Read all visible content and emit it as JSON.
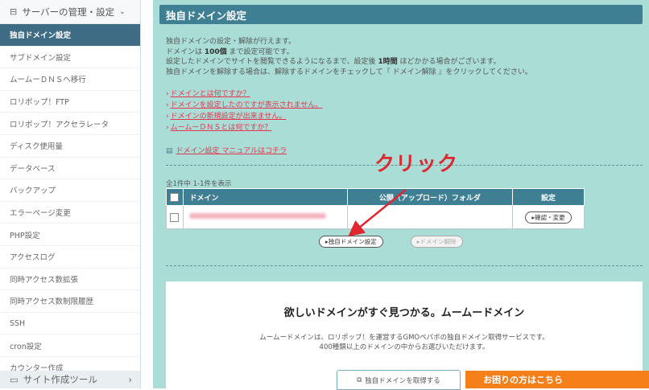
{
  "sidebar": {
    "header_icon": "server-icon",
    "header": "サーバーの管理・設定",
    "items": [
      {
        "label": "独自ドメイン設定",
        "active": true
      },
      {
        "label": "サブドメイン設定"
      },
      {
        "label": "ムームーＤＮＳへ移行"
      },
      {
        "label": "ロリポップ！FTP"
      },
      {
        "label": "ロリポップ！アクセラレータ"
      },
      {
        "label": "ディスク使用量"
      },
      {
        "label": "データベース"
      },
      {
        "label": "バックアップ"
      },
      {
        "label": "エラーページ変更"
      },
      {
        "label": "PHP設定"
      },
      {
        "label": "アクセスログ"
      },
      {
        "label": "同時アクセス数拡張"
      },
      {
        "label": "同時アクセス数制限履歴"
      },
      {
        "label": "SSH"
      },
      {
        "label": "cron設定"
      },
      {
        "label": "カウンター作成"
      }
    ],
    "footer": "サイト作成ツール"
  },
  "page": {
    "title": "独自ドメイン設定",
    "desc1": "独自ドメインの設定・解除が行えます。",
    "desc2_pre": "ドメインは ",
    "desc2_bold": "100個",
    "desc2_post": " まで設定可能です。",
    "desc3_pre": "設定したドメインでサイトを閲覧できるようになるまで、設定後 ",
    "desc3_bold": "1時間",
    "desc3_post": " ほどかかる場合がございます。",
    "desc4": "独自ドメインを解除する場合は、解除するドメインをチェックして『 ドメイン解除 』をクリックしてください。",
    "links": [
      "ドメインとは何ですか？",
      "ドメインを設定したのですが表示されません。",
      "ドメインの新規設定が出来ません。",
      "ムームーＤＮＳとは何ですか？"
    ],
    "manual": "ドメイン設定 マニュアルはコチラ",
    "count": "全1件中 1-1件を表示",
    "table": {
      "col_domain": "ドメイン",
      "col_folder": "公開（アップロード）フォルダ",
      "col_setting": "設定",
      "edit_btn": "確認・変更"
    },
    "set_btn": "独自ドメイン設定",
    "remove_btn": "ドメイン解除"
  },
  "annotation": {
    "text": "クリック",
    "color": "#e0262f"
  },
  "ad": {
    "title": "欲しいドメインがすぐ見つかる。ムームードメイン",
    "desc1": "ムームードメインは、ロリポップ！を運営するGMOペパボの独自ドメイン取得サービスです。",
    "desc2": "400種類以上のドメインの中からお選びいただけます。",
    "btn": "独自ドメインを取得する"
  },
  "help": "お困りの方はこちら",
  "colors": {
    "accent": "#3f7f94",
    "bg": "#a9ddd6",
    "link": "#e2374f",
    "help": "#f57f18"
  }
}
